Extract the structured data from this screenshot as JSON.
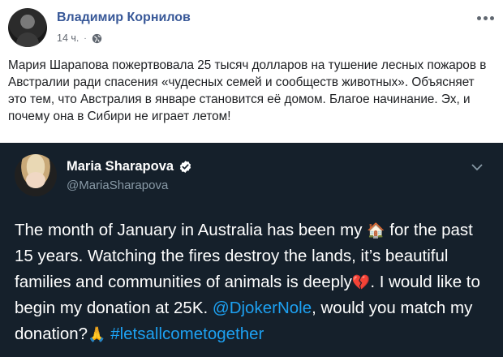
{
  "post": {
    "author": "Владимир Корнилов",
    "time": "14 ч.",
    "separator": "·",
    "text": "Мария Шарапова пожертвовала 25 тысяч долларов на тушение лесных пожаров в Австралии ради спасения «чудесных семей и сообществ животных». Объясняет это тем, что Австралия в январе становится её домом. Благое начинание. Эх, и почему она в Сибири не играет летом!"
  },
  "tweet": {
    "name": "Maria Sharapova",
    "handle": "@MariaSharapova",
    "text_1": "The month of January in Australia has been my ",
    "emoji_house": "🏠",
    "text_2": " for the past 15 years. Watching the fires destroy the lands, it’s beautiful families and communities of animals is deeply",
    "emoji_heart": "💔",
    "text_3": ". I would like to begin my donation at 25K. ",
    "mention": "@DjokerNole",
    "text_4": ", would you match my donation?",
    "emoji_pray": "🙏",
    "text_5": " ",
    "hashtag": "#letsallcometogether"
  },
  "colors": {
    "author_link": "#385898",
    "tweet_bg": "#15202b",
    "twitter_blue": "#1da1f2",
    "handle_gray": "#8899a6"
  },
  "icons": [
    "globe-icon",
    "more-icon",
    "verified-icon",
    "chevron-down-icon"
  ]
}
